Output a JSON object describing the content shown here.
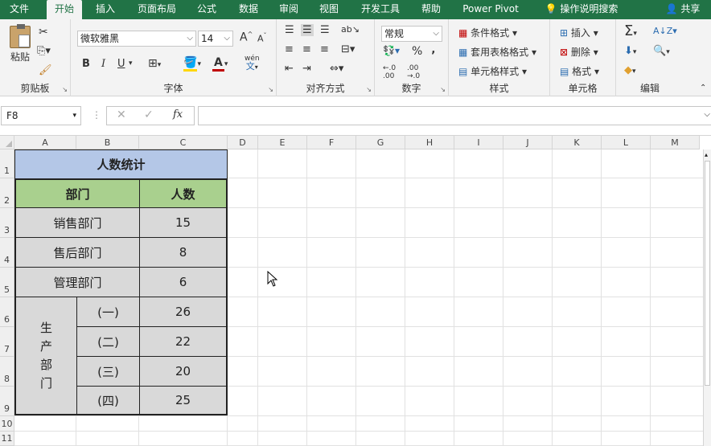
{
  "tabs": [
    "文件",
    "开始",
    "插入",
    "页面布局",
    "公式",
    "数据",
    "审阅",
    "视图",
    "开发工具",
    "帮助",
    "Power Pivot",
    "操作说明搜索",
    "共享"
  ],
  "ribbon": {
    "clipboard": {
      "label": "剪贴板",
      "paste": "粘贴"
    },
    "font": {
      "label": "字体",
      "name": "微软雅黑",
      "size": "14",
      "bold": "B",
      "italic": "I",
      "underline": "U",
      "grow": "A",
      "shrink": "A",
      "color_letter": "A",
      "phonetic": "wén"
    },
    "align": {
      "label": "对齐方式"
    },
    "number": {
      "label": "数字",
      "format": "常规",
      "percent": "%",
      "comma": "‚"
    },
    "styles": {
      "label": "样式",
      "conditional": "条件格式",
      "table": "套用表格格式",
      "cell": "单元格样式"
    },
    "cells": {
      "label": "单元格",
      "insert": "插入",
      "delete": "删除",
      "format": "格式"
    },
    "editing": {
      "label": "编辑"
    }
  },
  "formula_bar": {
    "name_box": "F8",
    "formula": ""
  },
  "columns": [
    "A",
    "B",
    "C",
    "D",
    "E",
    "F",
    "G",
    "H",
    "I",
    "J",
    "K",
    "L",
    "M"
  ],
  "rows": [
    "1",
    "2",
    "3",
    "4",
    "5",
    "6",
    "7",
    "8",
    "9",
    "10",
    "11"
  ],
  "table": {
    "title": "人数统计",
    "header_dept": "部门",
    "header_count": "人数",
    "rows": [
      {
        "dept": "销售部门",
        "count": "15"
      },
      {
        "dept": "售后部门",
        "count": "8"
      },
      {
        "dept": "管理部门",
        "count": "6"
      }
    ],
    "production_label": [
      "生",
      "产",
      "部",
      "门"
    ],
    "production_rows": [
      {
        "sub": "(一)",
        "count": "26"
      },
      {
        "sub": "(二)",
        "count": "22"
      },
      {
        "sub": "(三)",
        "count": "20"
      },
      {
        "sub": "(四)",
        "count": "25"
      }
    ]
  },
  "colors": {
    "accent": "#217346",
    "title_fill": "#b4c7e7",
    "header_fill": "#a9d08e",
    "body_fill": "#d9d9d9"
  }
}
